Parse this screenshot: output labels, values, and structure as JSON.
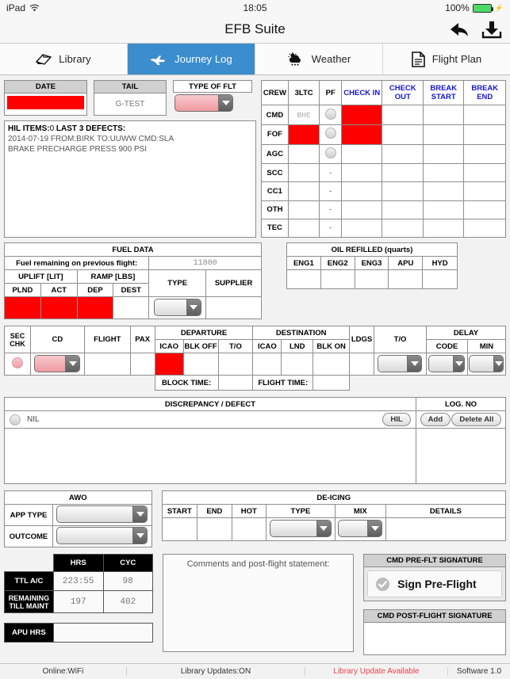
{
  "status_bar": {
    "device": "iPad",
    "wifi_icon": "wifi-icon",
    "time": "18:05",
    "battery_percent": "100%"
  },
  "header": {
    "title": "EFB Suite",
    "back_icon": "back-arrow-icon",
    "download_icon": "download-icon"
  },
  "tabs": [
    {
      "label": "Library",
      "icon": "book-icon",
      "active": false
    },
    {
      "label": "Journey Log",
      "icon": "airplane-icon",
      "active": true
    },
    {
      "label": "Weather",
      "icon": "cloud-sun-icon",
      "active": false
    },
    {
      "label": "Flight Plan",
      "icon": "document-icon",
      "active": false
    }
  ],
  "top": {
    "date": {
      "label": "DATE",
      "value": ""
    },
    "tail": {
      "label": "TAIL",
      "value": "G-TEST"
    },
    "type_of_flt": {
      "label": "TYPE OF FLT",
      "value": ""
    }
  },
  "hil": {
    "title_bold": "HIL ITEMS:",
    "count": "0",
    "title_bold2": " LAST 3 DEFECTS:",
    "lines": [
      "2014-07-19 FROM:BIRK TO:UUWW CMD:SLA",
      "BRAKE PRECHARGE PRESS 900 PSI"
    ]
  },
  "crew": {
    "headers": [
      "CREW",
      "3LTC",
      "PF",
      "CHECK IN",
      "CHECK OUT",
      "BREAK START",
      "BREAK END"
    ],
    "rows": [
      {
        "role": "CMD",
        "ltc": "BHE",
        "ltc_red": false,
        "pf": "radio",
        "checkin_red": true
      },
      {
        "role": "FOF",
        "ltc": "",
        "ltc_red": true,
        "pf": "radio",
        "checkin_red": true
      },
      {
        "role": "AGC",
        "ltc": "",
        "ltc_red": false,
        "pf": "radio",
        "checkin_red": false
      },
      {
        "role": "SCC",
        "ltc": "",
        "ltc_red": false,
        "pf": "-",
        "checkin_red": false
      },
      {
        "role": "CC1",
        "ltc": "",
        "ltc_red": false,
        "pf": "-",
        "checkin_red": false
      },
      {
        "role": "OTH",
        "ltc": "",
        "ltc_red": false,
        "pf": "-",
        "checkin_red": false
      },
      {
        "role": "TEC",
        "ltc": "",
        "ltc_red": false,
        "pf": "-",
        "checkin_red": false
      }
    ]
  },
  "fuel": {
    "title": "FUEL DATA",
    "prev_label": "Fuel remaining on previous flight:",
    "prev_value": "11800",
    "uplift": "UPLIFT [LIT]",
    "ramp": "RAMP [LBS]",
    "cols": [
      "PLND",
      "ACT",
      "DEP",
      "DEST"
    ],
    "type": "TYPE",
    "supplier": "SUPPLIER",
    "supplier_value": "",
    "type_value": ""
  },
  "oil": {
    "title": "OIL REFILLED (quarts)",
    "cols": [
      "ENG1",
      "ENG2",
      "ENG3",
      "APU",
      "HYD"
    ],
    "values": [
      "",
      "",
      "",
      "",
      ""
    ]
  },
  "sectors": {
    "sec_chk": "SEC CHK",
    "cd": "CD",
    "cd_value": "",
    "flight": "FLIGHT",
    "flight_value": "",
    "pax": "PAX",
    "pax_value": "",
    "departure": "DEPARTURE",
    "dep_icao": "ICAO",
    "dep_blk_off": "BLK OFF",
    "dep_to": "T/O",
    "destination": "DESTINATION",
    "dest_icao": "ICAO",
    "dest_lnd": "LND",
    "dest_blk_on": "BLK ON",
    "ldgs": "LDGS",
    "ldgs_value": "",
    "to": "T/O",
    "to_value": "",
    "delay": "DELAY",
    "delay_code": "CODE",
    "delay_min": "MIN",
    "delay_code_value": "",
    "delay_min_value": "",
    "block_time": "BLOCK TIME:",
    "block_time_value": "",
    "flight_time": "FLIGHT TIME:",
    "flight_time_value": ""
  },
  "discrepancy": {
    "title": "DISCREPANCY / DEFECT",
    "log_no": "LOG. NO",
    "nil_label": "NIL",
    "hil_button": "HIL",
    "add_button": "Add",
    "delete_all_button": "Delete All"
  },
  "awo": {
    "title": "AWO",
    "app_type": "APP TYPE",
    "app_type_value": "",
    "outcome": "OUTCOME",
    "outcome_value": ""
  },
  "deicing": {
    "title": "DE-ICING",
    "cols": [
      "START",
      "END",
      "HOT",
      "TYPE",
      "MIX",
      "DETAILS"
    ],
    "start_value": "",
    "end_value": "",
    "hot_value": "",
    "type_value": "",
    "mix_value": "",
    "details_value": ""
  },
  "aircraft_hours": {
    "cols": [
      "HRS",
      "CYC"
    ],
    "rows": [
      {
        "label": "TTL A/C",
        "hrs": "223:55",
        "cyc": "98"
      },
      {
        "label": "REMAINING TILL MAINT",
        "hrs": "197",
        "cyc": "402"
      }
    ],
    "apu_label": "APU HRS",
    "apu_value": ""
  },
  "comments": {
    "placeholder": "Comments and post-flight statement:",
    "value": ""
  },
  "signatures": {
    "pre_title": "CMD PRE-FLT SIGNATURE",
    "pre_button": "Sign Pre-Flight",
    "pre_icon": "check-circle-icon",
    "post_title": "CMD POST-FLIGHT SIGNATURE",
    "post_value": ""
  },
  "footer": {
    "online": "Online:WiFi",
    "library_updates": "Library Updates:ON",
    "library_alert": "Library Update Available",
    "software": "Software 1.0"
  },
  "colors": {
    "accent": "#3c8dcd",
    "red": "#fe0000",
    "header_grey": "#d0d0d0",
    "alert": "#e8444c"
  }
}
